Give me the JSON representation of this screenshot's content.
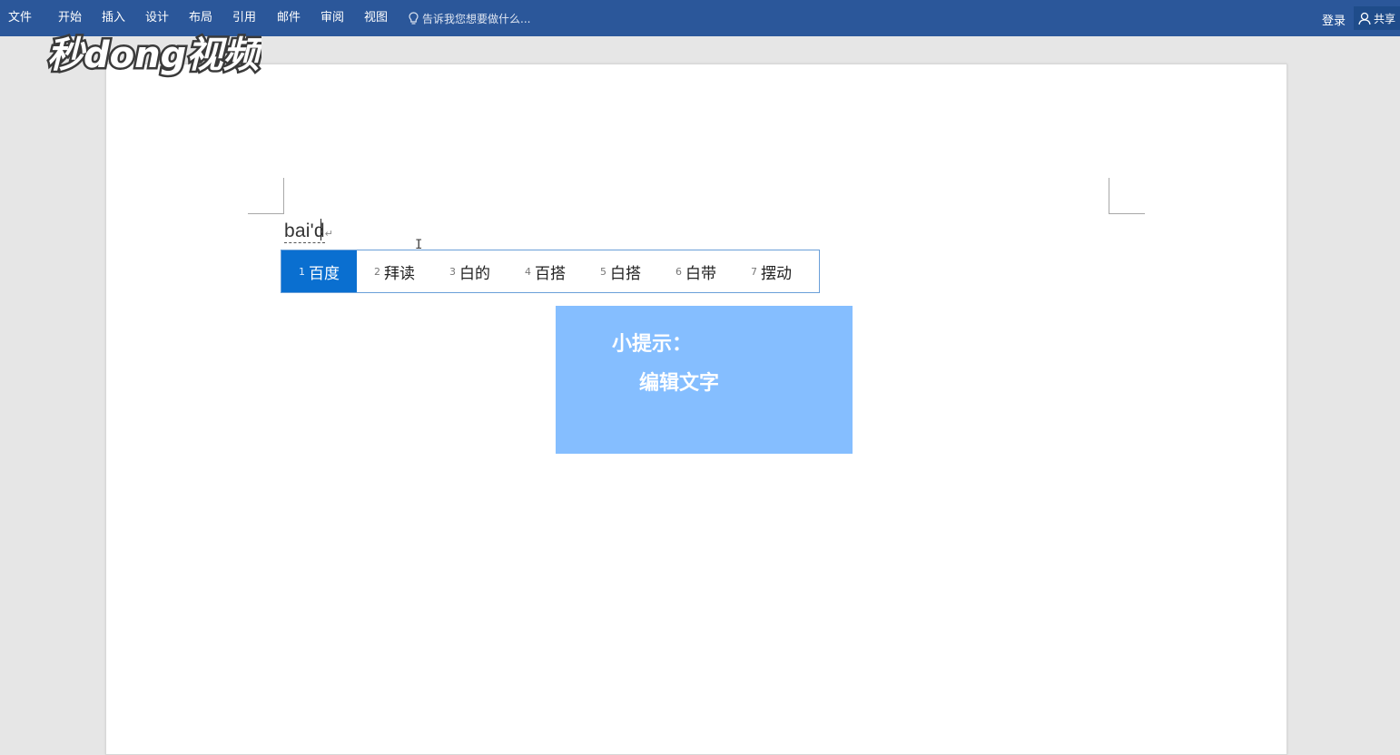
{
  "ribbon": {
    "menu": [
      "文件",
      "开始",
      "插入",
      "设计",
      "布局",
      "引用",
      "邮件",
      "审阅",
      "视图"
    ],
    "tell_me": "告诉我您想要做什么...",
    "tell_me_icon": "lightbulb-icon",
    "sign_in": "登录",
    "share": "共享",
    "share_icon": "person-icon"
  },
  "watermark": {
    "text": "秒dong视频"
  },
  "document": {
    "typed_text": "bai'd",
    "paragraph_mark": "↵",
    "cursor_icon": "text-cursor-icon"
  },
  "ime": {
    "candidates": [
      {
        "num": "1",
        "text": "百度",
        "selected": true
      },
      {
        "num": "2",
        "text": "拜读"
      },
      {
        "num": "3",
        "text": "白的"
      },
      {
        "num": "4",
        "text": "百搭"
      },
      {
        "num": "5",
        "text": "白搭"
      },
      {
        "num": "6",
        "text": "白带"
      },
      {
        "num": "7",
        "text": "摆动"
      }
    ]
  },
  "tip": {
    "title": "小提示：",
    "body": "编辑文字"
  },
  "colors": {
    "ribbon": "#2b579a",
    "canvas": "#e6e6e6",
    "selected_candidate": "#0a6fd0",
    "tip_box": "#85beff"
  }
}
